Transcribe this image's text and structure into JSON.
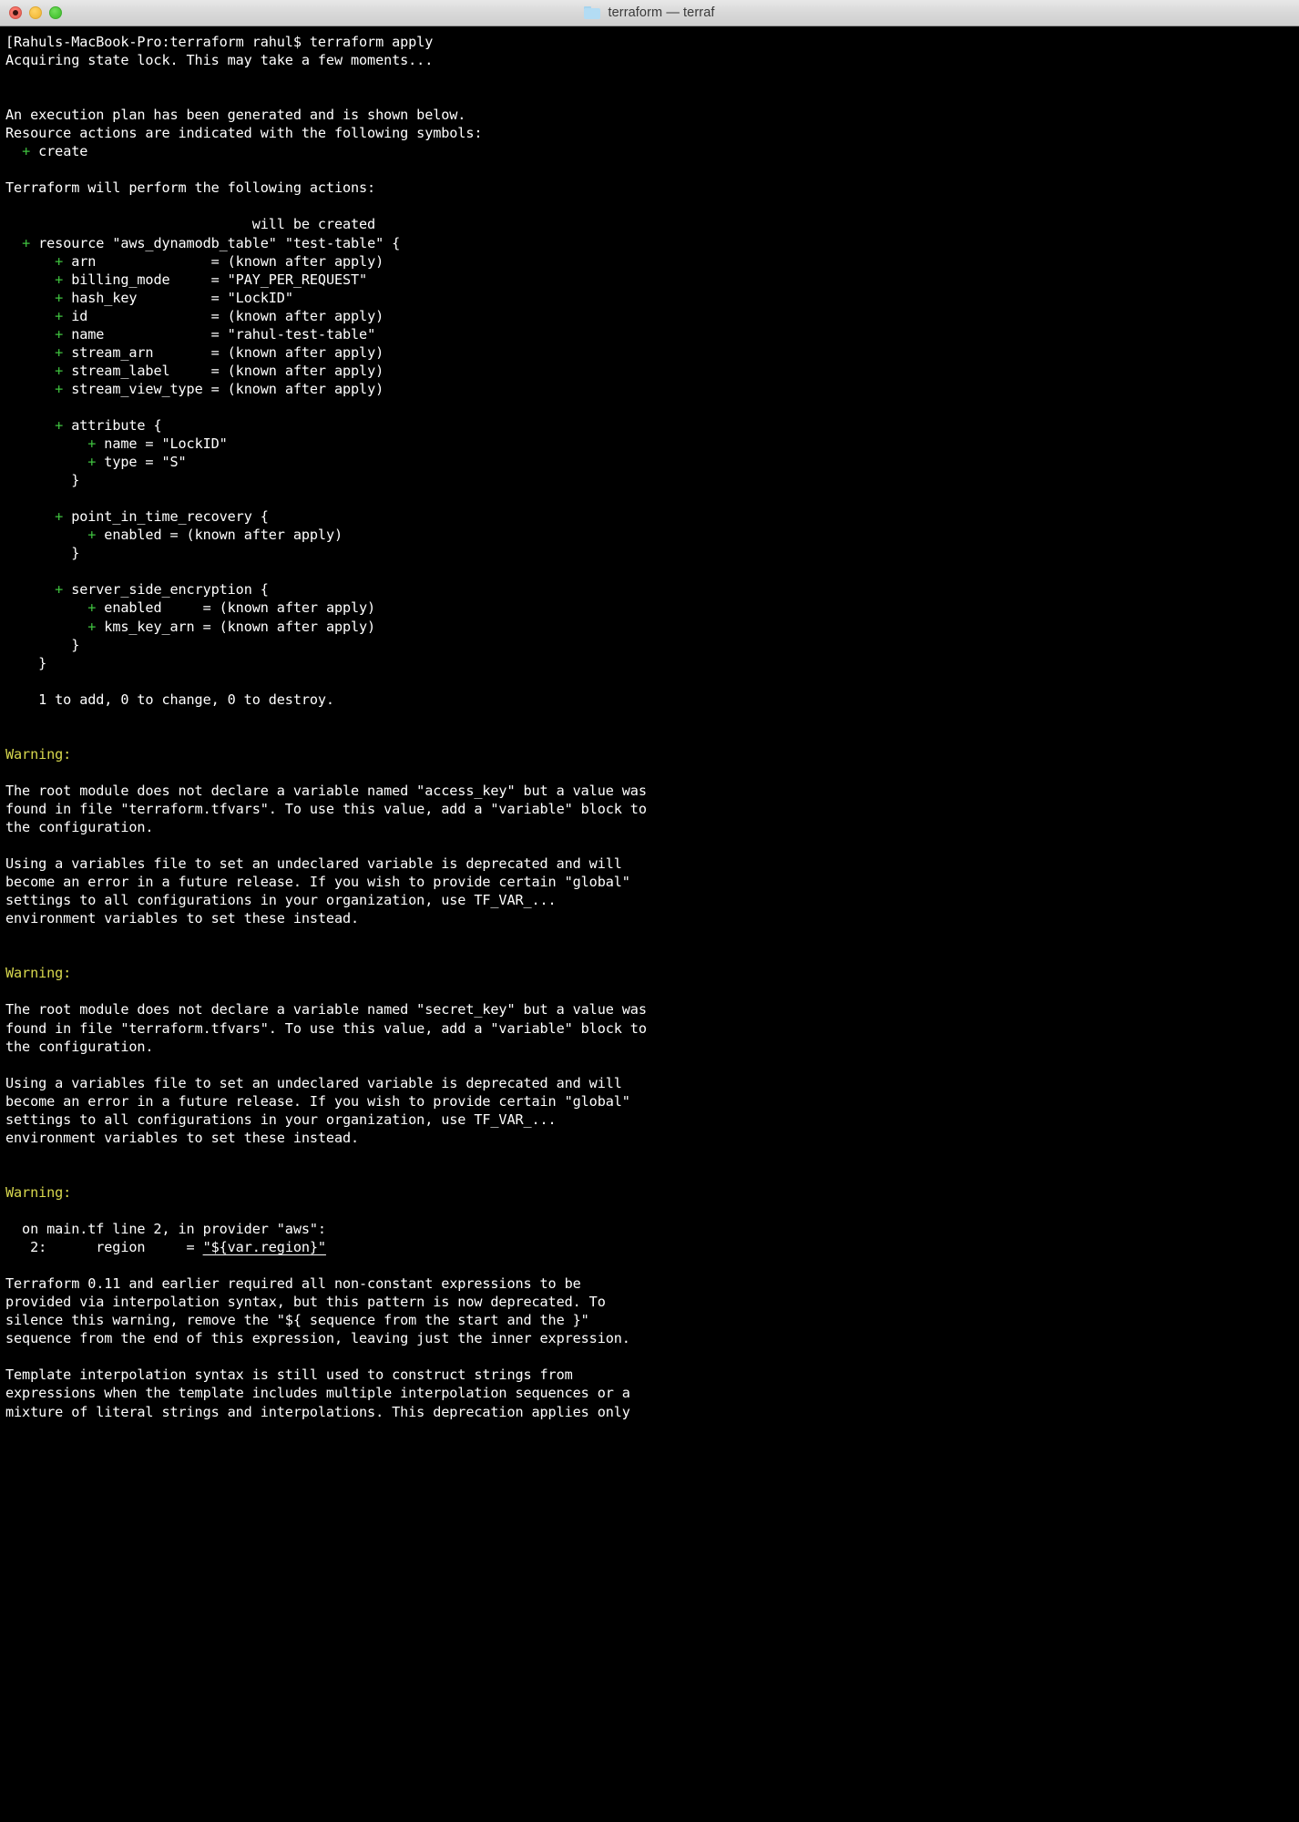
{
  "window": {
    "title": "terraform — terraf",
    "folder_icon": "folder-icon",
    "controls": {
      "close": "close-button",
      "minimize": "minimize-button",
      "maximize": "maximize-button"
    }
  },
  "terminal": {
    "prompt_host": "Rahuls-MacBook-Pro",
    "prompt_dir": "terraform",
    "prompt_user": "rahul",
    "command": "terraform apply",
    "colors": {
      "background": "#000000",
      "foreground": "#ffffff",
      "green": "#3fc23f",
      "yellow": "#d8d84e"
    },
    "lines": [
      {
        "id": "l1",
        "segments": [
          {
            "text": "[Rahuls-MacBook-Pro:terraform rahul$ terraform apply"
          }
        ]
      },
      {
        "id": "l2",
        "segments": [
          {
            "text": "Acquiring state lock. This may take a few moments..."
          }
        ]
      },
      {
        "id": "l3",
        "segments": [
          {
            "text": ""
          }
        ]
      },
      {
        "id": "l4",
        "segments": [
          {
            "text": ""
          }
        ]
      },
      {
        "id": "l5",
        "segments": [
          {
            "text": "An execution plan has been generated and is shown below."
          }
        ]
      },
      {
        "id": "l6",
        "segments": [
          {
            "text": "Resource actions are indicated with the following symbols:"
          }
        ]
      },
      {
        "id": "l7",
        "segments": [
          {
            "text": "  "
          },
          {
            "text": "+",
            "cls": "plus"
          },
          {
            "text": " create"
          }
        ]
      },
      {
        "id": "l8",
        "segments": [
          {
            "text": ""
          }
        ]
      },
      {
        "id": "l9",
        "segments": [
          {
            "text": "Terraform will perform the following actions:"
          }
        ]
      },
      {
        "id": "l10",
        "segments": [
          {
            "text": ""
          }
        ]
      },
      {
        "id": "l11",
        "segments": [
          {
            "text": "                              will be created"
          }
        ]
      },
      {
        "id": "l12",
        "segments": [
          {
            "text": "  "
          },
          {
            "text": "+",
            "cls": "plus"
          },
          {
            "text": " resource \"aws_dynamodb_table\" \"test-table\" {"
          }
        ]
      },
      {
        "id": "l13",
        "segments": [
          {
            "text": "      "
          },
          {
            "text": "+",
            "cls": "plus"
          },
          {
            "text": " arn              = (known after apply)"
          }
        ]
      },
      {
        "id": "l14",
        "segments": [
          {
            "text": "      "
          },
          {
            "text": "+",
            "cls": "plus"
          },
          {
            "text": " billing_mode     = \"PAY_PER_REQUEST\""
          }
        ]
      },
      {
        "id": "l15",
        "segments": [
          {
            "text": "      "
          },
          {
            "text": "+",
            "cls": "plus"
          },
          {
            "text": " hash_key         = \"LockID\""
          }
        ]
      },
      {
        "id": "l16",
        "segments": [
          {
            "text": "      "
          },
          {
            "text": "+",
            "cls": "plus"
          },
          {
            "text": " id               = (known after apply)"
          }
        ]
      },
      {
        "id": "l17",
        "segments": [
          {
            "text": "      "
          },
          {
            "text": "+",
            "cls": "plus"
          },
          {
            "text": " name             = \"rahul-test-table\""
          }
        ]
      },
      {
        "id": "l18",
        "segments": [
          {
            "text": "      "
          },
          {
            "text": "+",
            "cls": "plus"
          },
          {
            "text": " stream_arn       = (known after apply)"
          }
        ]
      },
      {
        "id": "l19",
        "segments": [
          {
            "text": "      "
          },
          {
            "text": "+",
            "cls": "plus"
          },
          {
            "text": " stream_label     = (known after apply)"
          }
        ]
      },
      {
        "id": "l20",
        "segments": [
          {
            "text": "      "
          },
          {
            "text": "+",
            "cls": "plus"
          },
          {
            "text": " stream_view_type = (known after apply)"
          }
        ]
      },
      {
        "id": "l21",
        "segments": [
          {
            "text": ""
          }
        ]
      },
      {
        "id": "l22",
        "segments": [
          {
            "text": "      "
          },
          {
            "text": "+",
            "cls": "plus"
          },
          {
            "text": " attribute {"
          }
        ]
      },
      {
        "id": "l23",
        "segments": [
          {
            "text": "          "
          },
          {
            "text": "+",
            "cls": "plus"
          },
          {
            "text": " name = \"LockID\""
          }
        ]
      },
      {
        "id": "l24",
        "segments": [
          {
            "text": "          "
          },
          {
            "text": "+",
            "cls": "plus"
          },
          {
            "text": " type = \"S\""
          }
        ]
      },
      {
        "id": "l25",
        "segments": [
          {
            "text": "        }"
          }
        ]
      },
      {
        "id": "l26",
        "segments": [
          {
            "text": ""
          }
        ]
      },
      {
        "id": "l27",
        "segments": [
          {
            "text": "      "
          },
          {
            "text": "+",
            "cls": "plus"
          },
          {
            "text": " point_in_time_recovery {"
          }
        ]
      },
      {
        "id": "l28",
        "segments": [
          {
            "text": "          "
          },
          {
            "text": "+",
            "cls": "plus"
          },
          {
            "text": " enabled = (known after apply)"
          }
        ]
      },
      {
        "id": "l29",
        "segments": [
          {
            "text": "        }"
          }
        ]
      },
      {
        "id": "l30",
        "segments": [
          {
            "text": ""
          }
        ]
      },
      {
        "id": "l31",
        "segments": [
          {
            "text": "      "
          },
          {
            "text": "+",
            "cls": "plus"
          },
          {
            "text": " server_side_encryption {"
          }
        ]
      },
      {
        "id": "l32",
        "segments": [
          {
            "text": "          "
          },
          {
            "text": "+",
            "cls": "plus"
          },
          {
            "text": " enabled     = (known after apply)"
          }
        ]
      },
      {
        "id": "l33",
        "segments": [
          {
            "text": "          "
          },
          {
            "text": "+",
            "cls": "plus"
          },
          {
            "text": " kms_key_arn = (known after apply)"
          }
        ]
      },
      {
        "id": "l34",
        "segments": [
          {
            "text": "        }"
          }
        ]
      },
      {
        "id": "l35",
        "segments": [
          {
            "text": "    }"
          }
        ]
      },
      {
        "id": "l36",
        "segments": [
          {
            "text": ""
          }
        ]
      },
      {
        "id": "l37",
        "segments": [
          {
            "text": "    1 to add, 0 to change, 0 to destroy."
          }
        ]
      },
      {
        "id": "l38",
        "segments": [
          {
            "text": ""
          }
        ]
      },
      {
        "id": "l39",
        "segments": [
          {
            "text": ""
          }
        ]
      },
      {
        "id": "l40",
        "segments": [
          {
            "text": "Warning:",
            "cls": "warn"
          }
        ]
      },
      {
        "id": "l41",
        "segments": [
          {
            "text": ""
          }
        ]
      },
      {
        "id": "l42",
        "segments": [
          {
            "text": "The root module does not declare a variable named \"access_key\" but a value was"
          }
        ]
      },
      {
        "id": "l43",
        "segments": [
          {
            "text": "found in file \"terraform.tfvars\". To use this value, add a \"variable\" block to"
          }
        ]
      },
      {
        "id": "l44",
        "segments": [
          {
            "text": "the configuration."
          }
        ]
      },
      {
        "id": "l45",
        "segments": [
          {
            "text": ""
          }
        ]
      },
      {
        "id": "l46",
        "segments": [
          {
            "text": "Using a variables file to set an undeclared variable is deprecated and will"
          }
        ]
      },
      {
        "id": "l47",
        "segments": [
          {
            "text": "become an error in a future release. If you wish to provide certain \"global\""
          }
        ]
      },
      {
        "id": "l48",
        "segments": [
          {
            "text": "settings to all configurations in your organization, use TF_VAR_..."
          }
        ]
      },
      {
        "id": "l49",
        "segments": [
          {
            "text": "environment variables to set these instead."
          }
        ]
      },
      {
        "id": "l50",
        "segments": [
          {
            "text": ""
          }
        ]
      },
      {
        "id": "l51",
        "segments": [
          {
            "text": ""
          }
        ]
      },
      {
        "id": "l52",
        "segments": [
          {
            "text": "Warning:",
            "cls": "warn"
          }
        ]
      },
      {
        "id": "l53",
        "segments": [
          {
            "text": ""
          }
        ]
      },
      {
        "id": "l54",
        "segments": [
          {
            "text": "The root module does not declare a variable named \"secret_key\" but a value was"
          }
        ]
      },
      {
        "id": "l55",
        "segments": [
          {
            "text": "found in file \"terraform.tfvars\". To use this value, add a \"variable\" block to"
          }
        ]
      },
      {
        "id": "l56",
        "segments": [
          {
            "text": "the configuration."
          }
        ]
      },
      {
        "id": "l57",
        "segments": [
          {
            "text": ""
          }
        ]
      },
      {
        "id": "l58",
        "segments": [
          {
            "text": "Using a variables file to set an undeclared variable is deprecated and will"
          }
        ]
      },
      {
        "id": "l59",
        "segments": [
          {
            "text": "become an error in a future release. If you wish to provide certain \"global\""
          }
        ]
      },
      {
        "id": "l60",
        "segments": [
          {
            "text": "settings to all configurations in your organization, use TF_VAR_..."
          }
        ]
      },
      {
        "id": "l61",
        "segments": [
          {
            "text": "environment variables to set these instead."
          }
        ]
      },
      {
        "id": "l62",
        "segments": [
          {
            "text": ""
          }
        ]
      },
      {
        "id": "l63",
        "segments": [
          {
            "text": ""
          }
        ]
      },
      {
        "id": "l64",
        "segments": [
          {
            "text": "Warning:",
            "cls": "warn"
          }
        ]
      },
      {
        "id": "l65",
        "segments": [
          {
            "text": ""
          }
        ]
      },
      {
        "id": "l66",
        "segments": [
          {
            "text": "  on main.tf line 2, in provider \"aws\":"
          }
        ]
      },
      {
        "id": "l67",
        "segments": [
          {
            "text": "   2:      region     = "
          },
          {
            "text": "\"${var.region}\"",
            "cls": "uline"
          }
        ]
      },
      {
        "id": "l68",
        "segments": [
          {
            "text": ""
          }
        ]
      },
      {
        "id": "l69",
        "segments": [
          {
            "text": "Terraform 0.11 and earlier required all non-constant expressions to be"
          }
        ]
      },
      {
        "id": "l70",
        "segments": [
          {
            "text": "provided via interpolation syntax, but this pattern is now deprecated. To"
          }
        ]
      },
      {
        "id": "l71",
        "segments": [
          {
            "text": "silence this warning, remove the \"${ sequence from the start and the }\""
          }
        ]
      },
      {
        "id": "l72",
        "segments": [
          {
            "text": "sequence from the end of this expression, leaving just the inner expression."
          }
        ]
      },
      {
        "id": "l73",
        "segments": [
          {
            "text": ""
          }
        ]
      },
      {
        "id": "l74",
        "segments": [
          {
            "text": "Template interpolation syntax is still used to construct strings from"
          }
        ]
      },
      {
        "id": "l75",
        "segments": [
          {
            "text": "expressions when the template includes multiple interpolation sequences or a"
          }
        ]
      },
      {
        "id": "l76",
        "segments": [
          {
            "text": "mixture of literal strings and interpolations. This deprecation applies only"
          }
        ]
      }
    ]
  }
}
